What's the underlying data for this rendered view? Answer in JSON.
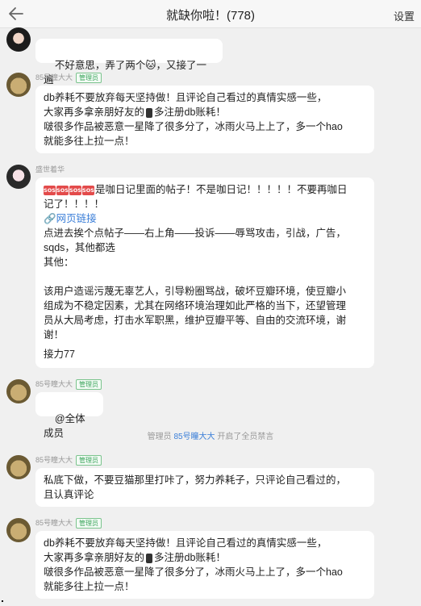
{
  "header": {
    "title": "就缺你啦！(778)",
    "settings_label": "设置",
    "back_icon": "arrow-left-icon"
  },
  "badge_label": "管理员",
  "messages": [
    {
      "sender": "",
      "text": "不好意思，弄了两个🐱，又接了一遍"
    },
    {
      "sender": "85号瞳大大",
      "text": "db养耗不要放弃每天坚持做！且评论自己看过的真情实感一些，\n大家再多拿亲朋好友的📱多注册db账耗！\n啵很多作品被恶意一星降了很多分了，冰雨火马上上了，多一个hao\n就能多往上拉一点！",
      "line1": "db养耗不要放弃每天坚持做！且评论自己看过的真情实感一些，",
      "line2a": "大家再多拿亲朋好友的",
      "line2b": "多注册db账耗！",
      "line3": "啵很多作品被恶意一星降了很多分了，冰雨火马上上了，多一个hao",
      "line4": "就能多往上拉一点！"
    },
    {
      "sender": "盛世着华",
      "sos_label": "SOS",
      "line1": "是咖日记里面的帖子！不是咖日记！！！！！不要再咖日",
      "line2": "记了！！！！",
      "link": "🔗网页链接",
      "line3": "点进去挨个点帖子——右上角——投诉——辱骂攻击，引战，广告，",
      "line4": "sqds，其他都选",
      "line5": "其他：",
      "line6": "该用户造谣污蔑无辜艺人，引导粉圈骂战，破坏豆瓣环境，使豆瓣小",
      "line7": "组成为不稳定因素，尤其在网络环境治理如此严格的当下，还望管理",
      "line8": "员从大局考虑，打击水军职黑，维护豆瓣平等、自由的交流环境，谢",
      "line9": "谢！",
      "line10": "接力77"
    },
    {
      "sender": "85号瞳大大",
      "text": "@全体成员"
    },
    {
      "sender": "85号瞳大大",
      "line1": "私底下做，不要豆猫那里打咔了，努力养耗子，只评论自己看过的，",
      "line2": "且认真评论"
    },
    {
      "sender": "85号瞳大大",
      "line1": "db养耗不要放弃每天坚持做！且评论自己看过的真情实感一些，",
      "line2a": "大家再多拿亲朋好友的",
      "line2b": "多注册db账耗！",
      "line3": "啵很多作品被恶意一星降了很多分了，冰雨火马上上了，多一个hao",
      "line4": "就能多往上拉一点！"
    }
  ],
  "system_notice": {
    "prefix": "管理员",
    "who": "85号瞳大大",
    "suffix": "开启了全员禁言"
  }
}
